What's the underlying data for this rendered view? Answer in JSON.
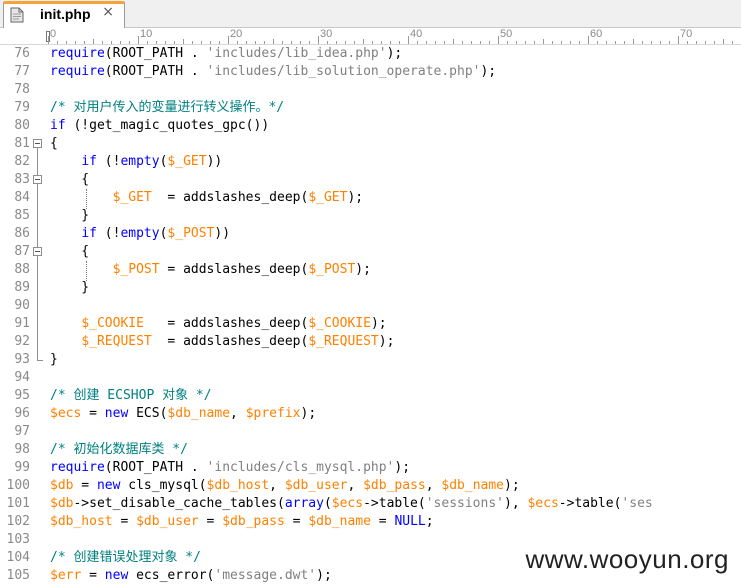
{
  "tab": {
    "title": "init.php",
    "close_glyph": "×",
    "icon": "file-icon"
  },
  "ruler": {
    "labels": [
      "0",
      "10",
      "20",
      "30",
      "40",
      "50",
      "60",
      "70"
    ]
  },
  "colors": {
    "keyword": "#0000ff",
    "string": "#808080",
    "comment": "#008080",
    "variable": "#ff8000",
    "operator": "#000080",
    "default": "#000000",
    "tab_accent": "#f7a33a"
  },
  "lines": [
    {
      "n": "76",
      "t": [
        [
          "k",
          "require"
        ],
        [
          "d",
          "(ROOT_PATH . "
        ],
        [
          "s",
          "'includes/lib_idea.php'"
        ],
        [
          "d",
          ");"
        ]
      ]
    },
    {
      "n": "77",
      "t": [
        [
          "k",
          "require"
        ],
        [
          "d",
          "(ROOT_PATH . "
        ],
        [
          "s",
          "'includes/lib_solution_operate.php'"
        ],
        [
          "d",
          ");"
        ]
      ]
    },
    {
      "n": "78",
      "t": []
    },
    {
      "n": "79",
      "t": [
        [
          "c",
          "/* 对用户传入的变量进行转义操作。*/"
        ]
      ]
    },
    {
      "n": "80",
      "t": [
        [
          "k",
          "if"
        ],
        [
          "d",
          " (!get_magic_quotes_gpc())"
        ]
      ]
    },
    {
      "n": "81",
      "t": [
        [
          "d",
          "{"
        ]
      ]
    },
    {
      "n": "82",
      "t": [
        [
          "d",
          "    "
        ],
        [
          "k",
          "if"
        ],
        [
          "d",
          " (!"
        ],
        [
          "k",
          "empty"
        ],
        [
          "d",
          "("
        ],
        [
          "v",
          "$_GET"
        ],
        [
          "d",
          "))"
        ]
      ]
    },
    {
      "n": "83",
      "t": [
        [
          "d",
          "    {"
        ]
      ]
    },
    {
      "n": "84",
      "t": [
        [
          "d",
          "        "
        ],
        [
          "v",
          "$_GET"
        ],
        [
          "d",
          "  = addslashes_deep("
        ],
        [
          "v",
          "$_GET"
        ],
        [
          "d",
          ");"
        ]
      ]
    },
    {
      "n": "85",
      "t": [
        [
          "d",
          "    }"
        ]
      ]
    },
    {
      "n": "86",
      "t": [
        [
          "d",
          "    "
        ],
        [
          "k",
          "if"
        ],
        [
          "d",
          " (!"
        ],
        [
          "k",
          "empty"
        ],
        [
          "d",
          "("
        ],
        [
          "v",
          "$_POST"
        ],
        [
          "d",
          "))"
        ]
      ]
    },
    {
      "n": "87",
      "t": [
        [
          "d",
          "    {"
        ]
      ]
    },
    {
      "n": "88",
      "t": [
        [
          "d",
          "        "
        ],
        [
          "v",
          "$_POST"
        ],
        [
          "d",
          " = addslashes_deep("
        ],
        [
          "v",
          "$_POST"
        ],
        [
          "d",
          ");"
        ]
      ]
    },
    {
      "n": "89",
      "t": [
        [
          "d",
          "    }"
        ]
      ]
    },
    {
      "n": "90",
      "t": []
    },
    {
      "n": "91",
      "t": [
        [
          "d",
          "    "
        ],
        [
          "v",
          "$_COOKIE"
        ],
        [
          "d",
          "   = addslashes_deep("
        ],
        [
          "v",
          "$_COOKIE"
        ],
        [
          "d",
          ");"
        ]
      ]
    },
    {
      "n": "92",
      "t": [
        [
          "d",
          "    "
        ],
        [
          "v",
          "$_REQUEST"
        ],
        [
          "d",
          "  = addslashes_deep("
        ],
        [
          "v",
          "$_REQUEST"
        ],
        [
          "d",
          ");"
        ]
      ]
    },
    {
      "n": "93",
      "t": [
        [
          "d",
          "}"
        ]
      ]
    },
    {
      "n": "94",
      "t": []
    },
    {
      "n": "95",
      "t": [
        [
          "c",
          "/* 创建 ECSHOP 对象 */"
        ]
      ]
    },
    {
      "n": "96",
      "t": [
        [
          "v",
          "$ecs"
        ],
        [
          "d",
          " = "
        ],
        [
          "k",
          "new"
        ],
        [
          "d",
          " ECS("
        ],
        [
          "v",
          "$db_name"
        ],
        [
          "d",
          ", "
        ],
        [
          "v",
          "$prefix"
        ],
        [
          "d",
          ");"
        ]
      ]
    },
    {
      "n": "97",
      "t": []
    },
    {
      "n": "98",
      "t": [
        [
          "c",
          "/* 初始化数据库类 */"
        ]
      ]
    },
    {
      "n": "99",
      "t": [
        [
          "k",
          "require"
        ],
        [
          "d",
          "(ROOT_PATH . "
        ],
        [
          "s",
          "'includes/cls_mysql.php'"
        ],
        [
          "d",
          ");"
        ]
      ]
    },
    {
      "n": "100",
      "t": [
        [
          "v",
          "$db"
        ],
        [
          "d",
          " = "
        ],
        [
          "k",
          "new"
        ],
        [
          "d",
          " cls_mysql("
        ],
        [
          "v",
          "$db_host"
        ],
        [
          "d",
          ", "
        ],
        [
          "v",
          "$db_user"
        ],
        [
          "d",
          ", "
        ],
        [
          "v",
          "$db_pass"
        ],
        [
          "d",
          ", "
        ],
        [
          "v",
          "$db_name"
        ],
        [
          "d",
          ");"
        ]
      ]
    },
    {
      "n": "101",
      "t": [
        [
          "v",
          "$db"
        ],
        [
          "d",
          "->set_disable_cache_tables("
        ],
        [
          "k",
          "array"
        ],
        [
          "d",
          "("
        ],
        [
          "v",
          "$ecs"
        ],
        [
          "d",
          "->table("
        ],
        [
          "s",
          "'sessions'"
        ],
        [
          "d",
          "), "
        ],
        [
          "v",
          "$ecs"
        ],
        [
          "d",
          "->table("
        ],
        [
          "s",
          "'ses"
        ]
      ]
    },
    {
      "n": "102",
      "t": [
        [
          "v",
          "$db_host"
        ],
        [
          "d",
          " = "
        ],
        [
          "v",
          "$db_user"
        ],
        [
          "d",
          " = "
        ],
        [
          "v",
          "$db_pass"
        ],
        [
          "d",
          " = "
        ],
        [
          "v",
          "$db_name"
        ],
        [
          "d",
          " = "
        ],
        [
          "k",
          "NULL"
        ],
        [
          "d",
          ";"
        ]
      ]
    },
    {
      "n": "103",
      "t": []
    },
    {
      "n": "104",
      "t": [
        [
          "c",
          "/* 创建错误处理对象 */"
        ]
      ]
    },
    {
      "n": "105",
      "t": [
        [
          "v",
          "$err"
        ],
        [
          "d",
          " = "
        ],
        [
          "k",
          "new"
        ],
        [
          "d",
          " ecs_error("
        ],
        [
          "s",
          "'message.dwt'"
        ],
        [
          "d",
          ");"
        ]
      ]
    }
  ],
  "watermark": "www.wooyun.org"
}
